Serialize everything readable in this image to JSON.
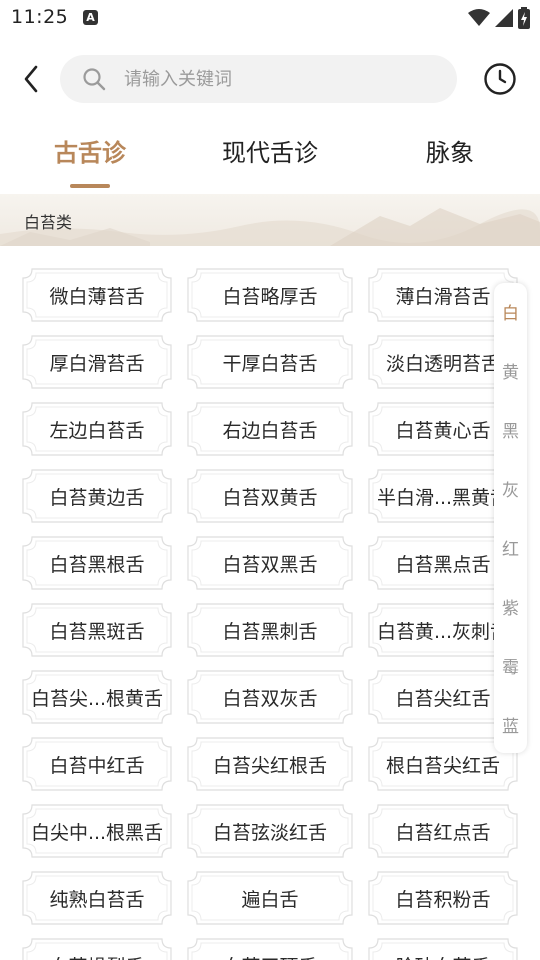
{
  "status": {
    "time": "11:25",
    "notif_glyph": "A"
  },
  "search": {
    "placeholder": "请输入关键词",
    "value": ""
  },
  "tabs": [
    {
      "label": "古舌诊",
      "active": true
    },
    {
      "label": "现代舌诊",
      "active": false
    },
    {
      "label": "脉象",
      "active": false
    }
  ],
  "section": {
    "title": "白苔类"
  },
  "items": [
    "微白薄苔舌",
    "白苔略厚舌",
    "薄白滑苔舌",
    "厚白滑苔舌",
    "干厚白苔舌",
    "淡白透明苔舌",
    "左边白苔舌",
    "右边白苔舌",
    "白苔黄心舌",
    "白苔黄边舌",
    "白苔双黄舌",
    "半白滑...黑黄舌",
    "白苔黑根舌",
    "白苔双黑舌",
    "白苔黑点舌",
    "白苔黑斑舌",
    "白苔黑刺舌",
    "白苔黄...灰刺舌",
    "白苔尖...根黄舌",
    "白苔双灰舌",
    "白苔尖红舌",
    "白苔中红舌",
    "白苔尖红根舌",
    "根白苔尖红舌",
    "白尖中...根黑舌",
    "白苔弦淡红舌",
    "白苔红点舌",
    "纯熟白苔舌",
    "遍白舌",
    "白苔积粉舌",
    "白苔燥裂舌",
    "白苔干硬舌",
    "脸砂白苔舌"
  ],
  "index": [
    {
      "label": "白",
      "active": true
    },
    {
      "label": "黄",
      "active": false
    },
    {
      "label": "黑",
      "active": false
    },
    {
      "label": "灰",
      "active": false
    },
    {
      "label": "红",
      "active": false
    },
    {
      "label": "紫",
      "active": false
    },
    {
      "label": "霉",
      "active": false
    },
    {
      "label": "蓝",
      "active": false
    }
  ],
  "colors": {
    "accent": "#b8875a",
    "chip_border": "#d8d8d8",
    "index_inactive": "#999999"
  },
  "icons": {
    "back": "chevron-left-icon",
    "search": "search-icon",
    "history": "clock-icon"
  }
}
